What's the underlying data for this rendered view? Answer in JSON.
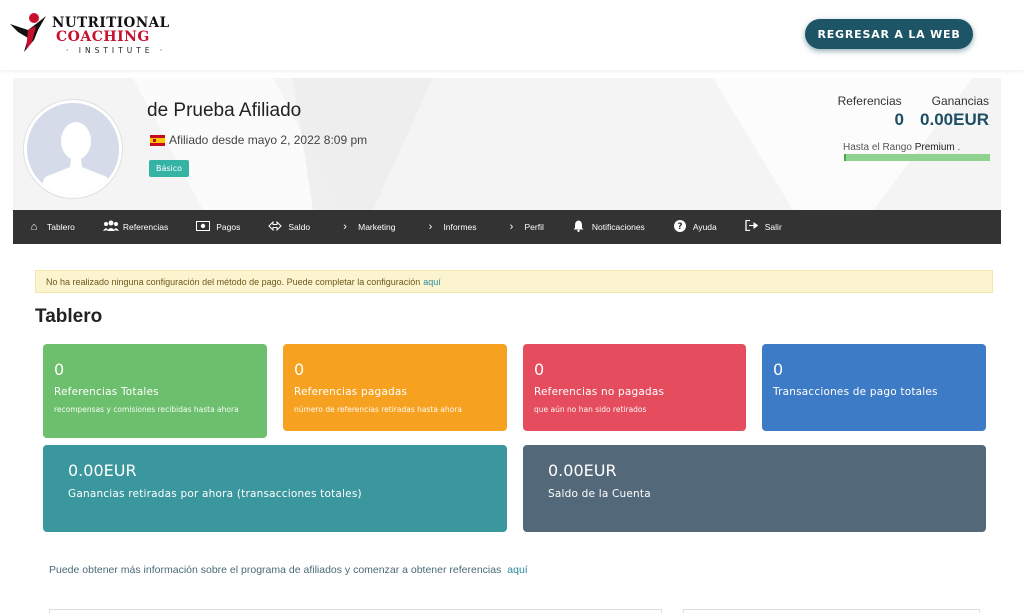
{
  "header": {
    "logo_line1": "NUTRITIONAL",
    "logo_line2": "COACHING",
    "logo_line3": "· INSTITUTE ·",
    "back_button": "REGRESAR A LA WEB"
  },
  "profile": {
    "name": "de Prueba Afiliado",
    "since": "Afiliado desde mayo 2, 2022 8:09 pm",
    "badge": "Básico",
    "stats": {
      "referrals_label": "Referencias",
      "earnings_label": "Ganancias",
      "referrals_value": "0",
      "earnings_value": "0.00EUR"
    },
    "rank": {
      "prefix": "Hasta el Rango",
      "name": "Premium",
      "suffix": " ."
    }
  },
  "nav": {
    "items": [
      {
        "label": "Tablero",
        "icon": "home-icon",
        "glyph": "⌂"
      },
      {
        "label": "Referencias",
        "icon": "users-icon",
        "glyph": "👥"
      },
      {
        "label": "Pagos",
        "icon": "money-icon",
        "glyph": "▣"
      },
      {
        "label": "Saldo",
        "icon": "exchange-icon",
        "glyph": "◇"
      },
      {
        "label": "Marketing",
        "icon": "chevron-right-icon",
        "glyph": "›"
      },
      {
        "label": "Informes",
        "icon": "chevron-right-icon",
        "glyph": "›"
      },
      {
        "label": "Perfil",
        "icon": "chevron-right-icon",
        "glyph": "›"
      },
      {
        "label": "Notificaciones",
        "icon": "bell-icon",
        "glyph": "🔔"
      },
      {
        "label": "Ayuda",
        "icon": "question-icon",
        "glyph": "?"
      },
      {
        "label": "Salir",
        "icon": "sign-out-icon",
        "glyph": "⇥"
      }
    ]
  },
  "alert": {
    "text": "No ha realizado ninguna configuración del método de pago. Puede completar la configuración",
    "link": "aquí"
  },
  "page_title": "Tablero",
  "cards": {
    "total_referrals": {
      "value": "0",
      "label": "Referencias Totales",
      "sub": "recompensas y comisiones recibidas hasta ahora",
      "color": "#6cbf6c"
    },
    "paid_referrals": {
      "value": "0",
      "label": "Referencias pagadas",
      "sub": "número de referencias retiradas hasta ahora",
      "color": "#f7a120"
    },
    "unpaid_referrals": {
      "value": "0",
      "label": "Referencias no pagadas",
      "sub": "que aún no han sido retirados",
      "color": "#e54d5e"
    },
    "total_transactions": {
      "value": "0",
      "label": "Transacciones de pago totales",
      "color": "#3e7bc6"
    },
    "withdrawn_earnings": {
      "value": "0.00EUR",
      "label": "Ganancias retiradas por ahora (transacciones totales)",
      "color": "#3a979e"
    },
    "account_balance": {
      "value": "0.00EUR",
      "label": "Saldo de la Cuenta",
      "color": "#53697a"
    }
  },
  "info": {
    "text": "Puede obtener más información sobre el programa de afiliados y comenzar a obtener referencias",
    "link": "aquí"
  },
  "colors": {
    "accent": "#1d5566",
    "nav_bg": "#333333",
    "badge": "#35b4a6",
    "link": "#2a8a9a"
  }
}
